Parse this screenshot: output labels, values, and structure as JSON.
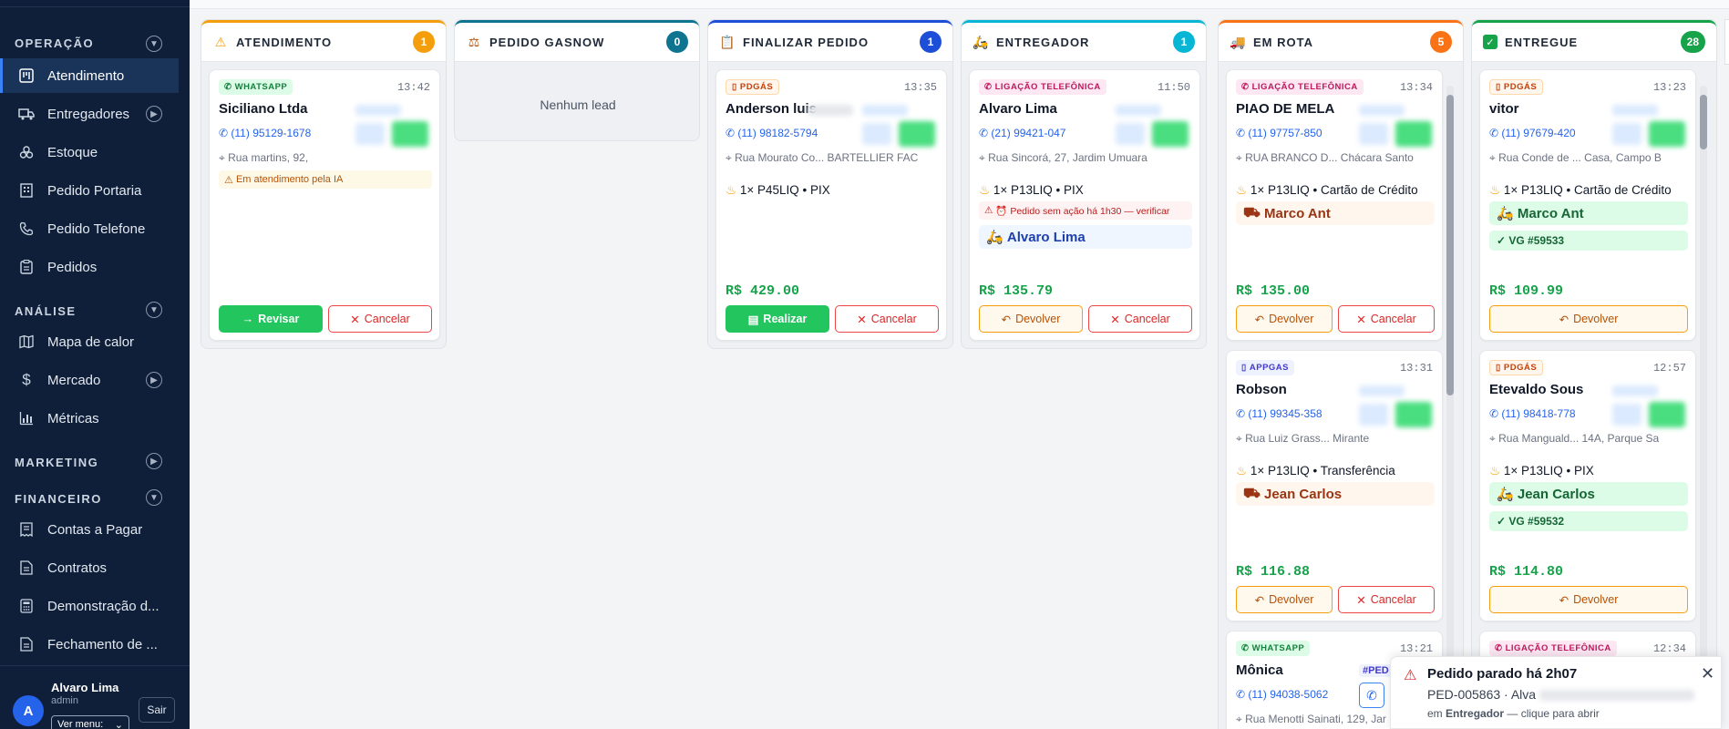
{
  "sidebar": {
    "sections": [
      {
        "label": "OPERAÇÃO"
      },
      {
        "label": "ANÁLISE"
      },
      {
        "label": "MARKETING"
      },
      {
        "label": "FINANCEIRO"
      }
    ],
    "items": [
      {
        "label": "Atendimento"
      },
      {
        "label": "Entregadores"
      },
      {
        "label": "Estoque"
      },
      {
        "label": "Pedido Portaria"
      },
      {
        "label": "Pedido Telefone"
      },
      {
        "label": "Pedidos"
      },
      {
        "label": "Mapa de calor"
      },
      {
        "label": "Mercado"
      },
      {
        "label": "Métricas"
      },
      {
        "label": "Contas a Pagar"
      },
      {
        "label": "Contratos"
      },
      {
        "label": "Demonstração d..."
      },
      {
        "label": "Fechamento de ..."
      }
    ],
    "user": {
      "initial": "A",
      "name": "Alvaro Lima",
      "role": "admin",
      "menu_label": "Ver menu:",
      "logout": "Sair"
    }
  },
  "columns": [
    {
      "title": "ATENDIMENTO",
      "count": "1",
      "color": "#f59e0b",
      "icon": "warning-icon"
    },
    {
      "title": "PEDIDO GASNOW",
      "count": "0",
      "color": "#0e7490",
      "icon": "scale-icon",
      "empty": "Nenhum lead"
    },
    {
      "title": "FINALIZAR PEDIDO",
      "count": "1",
      "color": "#1d4ed8",
      "icon": "clipboard-icon"
    },
    {
      "title": "ENTREGADOR",
      "count": "1",
      "color": "#06b6d4",
      "icon": "scooter-icon"
    },
    {
      "title": "EM ROTA",
      "count": "5",
      "color": "#f97316",
      "icon": "truck-icon"
    },
    {
      "title": "ENTREGUE",
      "count": "28",
      "color": "#16a34a",
      "icon": "check-icon"
    }
  ],
  "cards": {
    "atendimento1": {
      "tag": "WHATSAPP",
      "time": "13:42",
      "name": "Siciliano Ltda",
      "phone": "(11) 95129-1678",
      "address": "Rua martins, 92,",
      "alert": "Em atendimento pela IA",
      "btn_primary": "Revisar",
      "btn_cancel": "Cancelar"
    },
    "finalizar1": {
      "tag": "PDGÁS",
      "time": "13:35",
      "name": "Anderson luis",
      "phone": "(11) 98182-5794",
      "address": "Rua Mourato Co... BARTELLIER FAC",
      "product": "1× P45LIQ • PIX",
      "price": "R$ 429.00",
      "btn_primary": "Realizar",
      "btn_cancel": "Cancelar"
    },
    "entregador1": {
      "tag": "LIGAÇÃO TELEFÔNICA",
      "time": "11:50",
      "name": "Alvaro Lima",
      "phone": "(21) 99421-047",
      "address": "Rua Sincorá, 27, Jardim Umuara",
      "product": "1× P13LIQ • PIX",
      "alert": "⏰ Pedido sem ação há 1h30 — verificar",
      "driver": "Alvaro Lima",
      "price": "R$ 135.79",
      "btn_return": "Devolver",
      "btn_cancel": "Cancelar"
    },
    "rota1": {
      "tag": "LIGAÇÃO TELEFÔNICA",
      "time": "13:34",
      "name": "PIAO DE MELA",
      "phone": "(11) 97757-850",
      "address": "RUA BRANCO D... Chácara Santo",
      "product": "1× P13LIQ • Cartão de Crédito",
      "driver": "Marco Ant",
      "price": "R$ 135.00",
      "btn_return": "Devolver",
      "btn_cancel": "Cancelar"
    },
    "rota2": {
      "tag": "APPGAS",
      "time": "13:31",
      "name": "Robson",
      "phone": "(11) 99345-358",
      "address": "Rua Luiz Grass... Mirante",
      "product": "1× P13LIQ • Transferência",
      "driver": "Jean Carlos",
      "price": "R$ 116.88",
      "btn_return": "Devolver",
      "btn_cancel": "Cancelar"
    },
    "rota3": {
      "tag": "WHATSAPP",
      "time": "13:21",
      "name": "Mônica",
      "phone": "(11) 94038-5062",
      "address": "Rua Menotti Sainati, 129, Jar",
      "ped": "#PED"
    },
    "entregue1": {
      "tag": "PDGÁS",
      "time": "13:23",
      "name": "vitor",
      "phone": "(11) 97679-420",
      "address": "Rua Conde de ... Casa, Campo B",
      "product": "1× P13LIQ • Cartão de Crédito",
      "driver": "Marco Ant",
      "vg": "✓ VG #59533",
      "price": "R$ 109.99",
      "btn_return": "Devolver"
    },
    "entregue2": {
      "tag": "PDGÁS",
      "time": "12:57",
      "name": "Etevaldo Sous",
      "phone": "(11) 98418-778",
      "address": "Rua Manguald... 14A, Parque Sa",
      "product": "1× P13LIQ • PIX",
      "driver": "Jean Carlos",
      "vg": "✓ VG #59532",
      "price": "R$ 114.80",
      "btn_return": "Devolver"
    },
    "entregue3": {
      "tag": "LIGAÇÃO TELEFÔNICA",
      "time": "12:34"
    }
  },
  "toast": {
    "title": "Pedido parado há 2h07",
    "line": "PED-005863 · Alva",
    "sub_prefix": "em ",
    "sub_bold": "Entregador",
    "sub_suffix": " — clique para abrir"
  }
}
